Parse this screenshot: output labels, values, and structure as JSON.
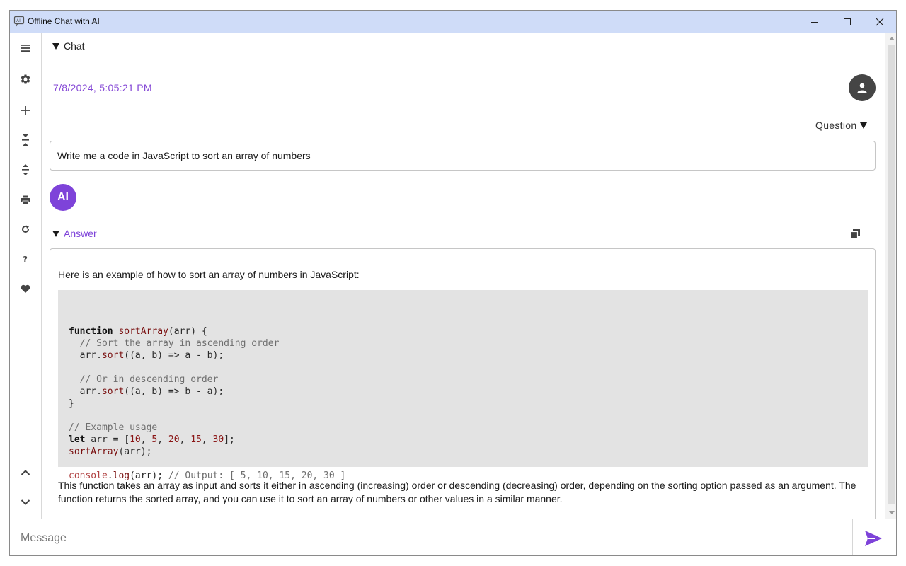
{
  "window": {
    "title": "Offline Chat with AI"
  },
  "sidebar": {
    "items": [
      {
        "name": "menu",
        "icon": "hamburger-menu-icon"
      },
      {
        "name": "settings",
        "icon": "gear-icon"
      },
      {
        "name": "new-chat",
        "icon": "plus-icon"
      },
      {
        "name": "collapse-all",
        "icon": "collapse-arrows-icon"
      },
      {
        "name": "expand-all",
        "icon": "expand-arrows-icon"
      },
      {
        "name": "print",
        "icon": "printer-icon"
      },
      {
        "name": "refresh",
        "icon": "refresh-icon"
      },
      {
        "name": "help",
        "icon": "question-mark-icon"
      },
      {
        "name": "favorite",
        "icon": "heart-icon"
      },
      {
        "name": "scroll-up",
        "icon": "chevron-up-icon"
      },
      {
        "name": "scroll-down",
        "icon": "chevron-down-icon"
      }
    ]
  },
  "chat": {
    "header_label": "Chat",
    "timestamp": "7/8/2024, 5:05:21 PM",
    "question_label": "Question",
    "question_text": "Write me a code in JavaScript to sort an array of numbers",
    "ai_avatar_label": "AI",
    "answer_label": "Answer",
    "answer_intro": "Here is an example of how to sort an array of numbers in JavaScript:",
    "code_lines": [
      "function sortArray(arr) {",
      "  // Sort the array in ascending order",
      "  arr.sort((a, b) => a - b);",
      "",
      "  // Or in descending order",
      "  arr.sort((a, b) => b - a);",
      "}",
      "",
      "// Example usage",
      "let arr = [10, 5, 20, 15, 30];",
      "sortArray(arr);",
      "",
      "console.log(arr); // Output: [ 5, 10, 15, 20, 30 ]"
    ],
    "answer_outro": "This function takes an array as input and sorts it either in ascending (increasing) order or descending (decreasing) order, depending on the sorting option passed as an argument. The function returns the sorted array, and you can use it to sort an array of numbers or other values in a similar manner."
  },
  "composer": {
    "placeholder": "Message",
    "value": ""
  },
  "colors": {
    "accent": "#7e43d9",
    "titlebar": "#cfdcf8",
    "user_avatar": "#454545",
    "code_bg": "#e3e3e3"
  }
}
